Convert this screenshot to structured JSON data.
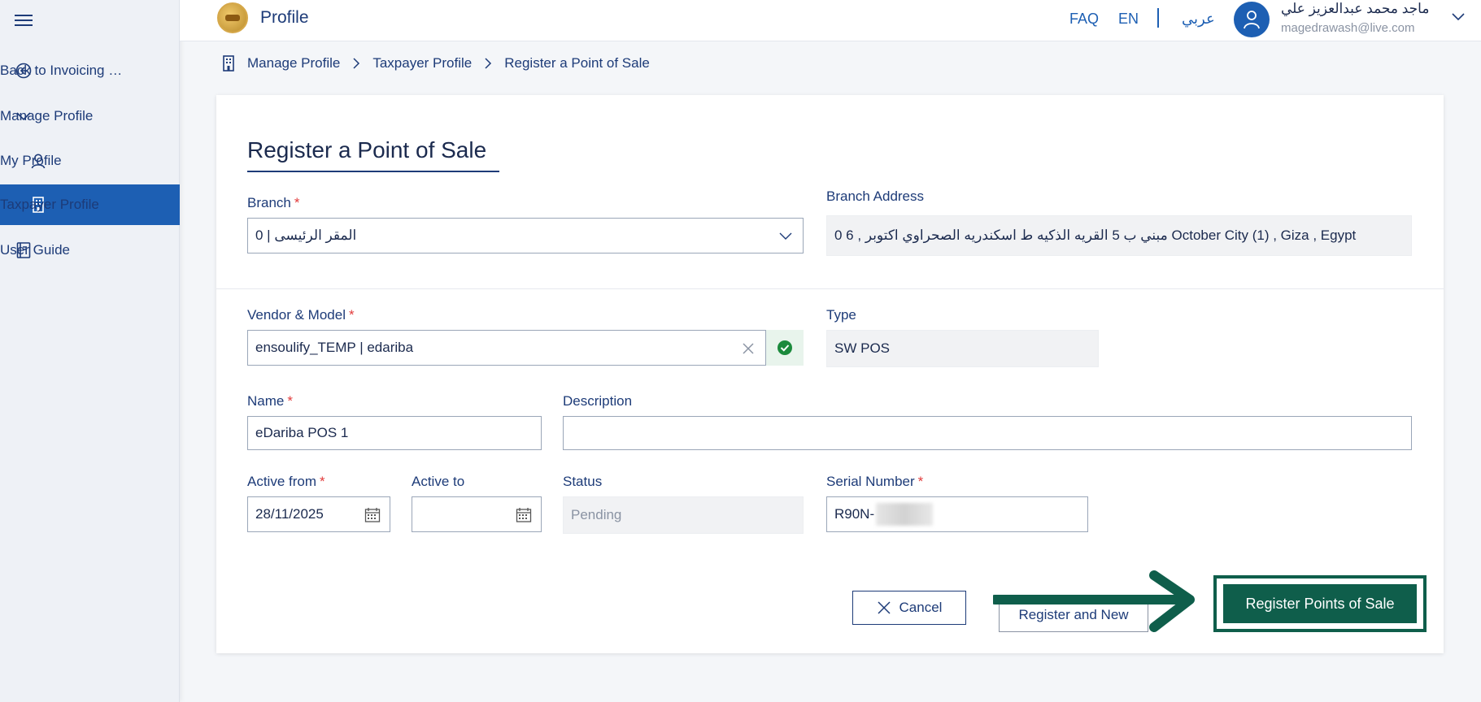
{
  "sidebar": {
    "items": [
      {
        "label": "Back to Invoicing Po...",
        "icon": "back-circle-icon"
      },
      {
        "label": "Manage Profile",
        "icon": "chevron-down-icon"
      },
      {
        "label": "My Profile",
        "icon": "person-icon"
      },
      {
        "label": "Taxpayer Profile",
        "icon": "building-icon"
      },
      {
        "label": "User Guide",
        "icon": "book-icon"
      }
    ]
  },
  "header": {
    "title": "Profile",
    "faq": "FAQ",
    "lang_en": "EN",
    "lang_ar": "عربي",
    "user_name": "ماجد محمد عبدالعزيز علي",
    "user_email": "magedrawash@live.com"
  },
  "breadcrumb": [
    "Manage Profile",
    "Taxpayer Profile",
    "Register a Point of Sale"
  ],
  "form": {
    "title": "Register a Point of Sale",
    "branch": {
      "label": "Branch",
      "value": "0 | المقر الرئيسى"
    },
    "branch_address": {
      "label": "Branch Address",
      "value": "0  6 , مبني ب 5 القريه الذكيه ط اسكندريه الصحراوي اكتوبر October City (1) , Giza , Egypt"
    },
    "vendor_model": {
      "label": "Vendor & Model",
      "value": "ensoulify_TEMP | edariba"
    },
    "type": {
      "label": "Type",
      "value": "SW POS"
    },
    "name": {
      "label": "Name",
      "value": "eDariba POS 1"
    },
    "description": {
      "label": "Description",
      "value": ""
    },
    "active_from": {
      "label": "Active from",
      "value": "28/11/2025"
    },
    "active_to": {
      "label": "Active to",
      "value": ""
    },
    "status": {
      "label": "Status",
      "value": "Pending"
    },
    "serial_number": {
      "label": "Serial Number",
      "value": "R90N-"
    },
    "required_mark": "*"
  },
  "actions": {
    "cancel": "Cancel",
    "register_and_new": "Register and New",
    "register": "Register Points of Sale"
  },
  "colors": {
    "primary": "#1d5fb3",
    "navy": "#1d3b78",
    "success": "#1b8a3c",
    "register_green": "#0f5e4b"
  }
}
